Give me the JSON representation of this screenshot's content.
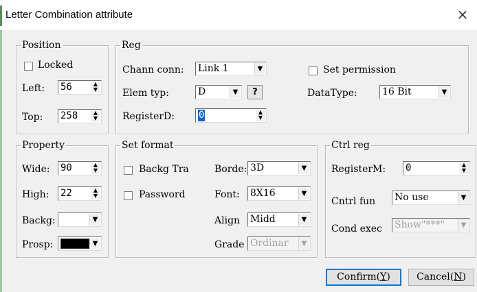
{
  "window": {
    "title": "Letter Combination attribute",
    "close_glyph": "×"
  },
  "position": {
    "legend": "Position",
    "locked_label": "Locked",
    "locked_checked": false,
    "left_label": "Left:",
    "left_value": "56",
    "top_label": "Top:",
    "top_value": "258"
  },
  "reg": {
    "legend": "Reg",
    "chann_conn_label": "Chann conn:",
    "chann_conn_value": "Link 1",
    "elem_typ_label": "Elem typ:",
    "elem_typ_value": "D",
    "help_label": "?",
    "registerd_label": "RegisterD:",
    "registerd_value": "0",
    "set_permission_label": "Set permission",
    "set_permission_checked": false,
    "datatype_label": "DataType:",
    "datatype_value": "16 Bit"
  },
  "property": {
    "legend": "Property",
    "wide_label": "Wide:",
    "wide_value": "90",
    "high_label": "High:",
    "high_value": "22",
    "backg_label": "Backg:",
    "backg_color": "#ffffff",
    "prosp_label": "Prosp:",
    "prosp_color": "#000000"
  },
  "set_format": {
    "legend": "Set format",
    "backg_tra_label": "Backg Tra",
    "backg_tra_checked": false,
    "password_label": "Password",
    "password_checked": false,
    "border_label": "Borde:",
    "border_value": "3D",
    "font_label": "Font:",
    "font_value": "8X16",
    "align_label": "Align",
    "align_value": "Midd",
    "grade_label": "Grade",
    "grade_value": "Ordinar"
  },
  "ctrl_reg": {
    "legend": "Ctrl reg",
    "registerm_label": "RegisterM:",
    "registerm_value": "0",
    "cntrl_fun_label": "Cntrl fun",
    "cntrl_fun_value": "No use",
    "cond_exec_label": "Cond exec",
    "cond_exec_value": "Show\"***\""
  },
  "buttons": {
    "confirm_text": "Confirm(",
    "confirm_key": "Y",
    "cancel_text": "Cancel(",
    "cancel_key": "N",
    "close_paren": ")"
  },
  "arrows": {
    "up": "▲",
    "down": "▼"
  },
  "colors": {
    "accent": "#0078d7",
    "highlight": "#0a64d2"
  }
}
